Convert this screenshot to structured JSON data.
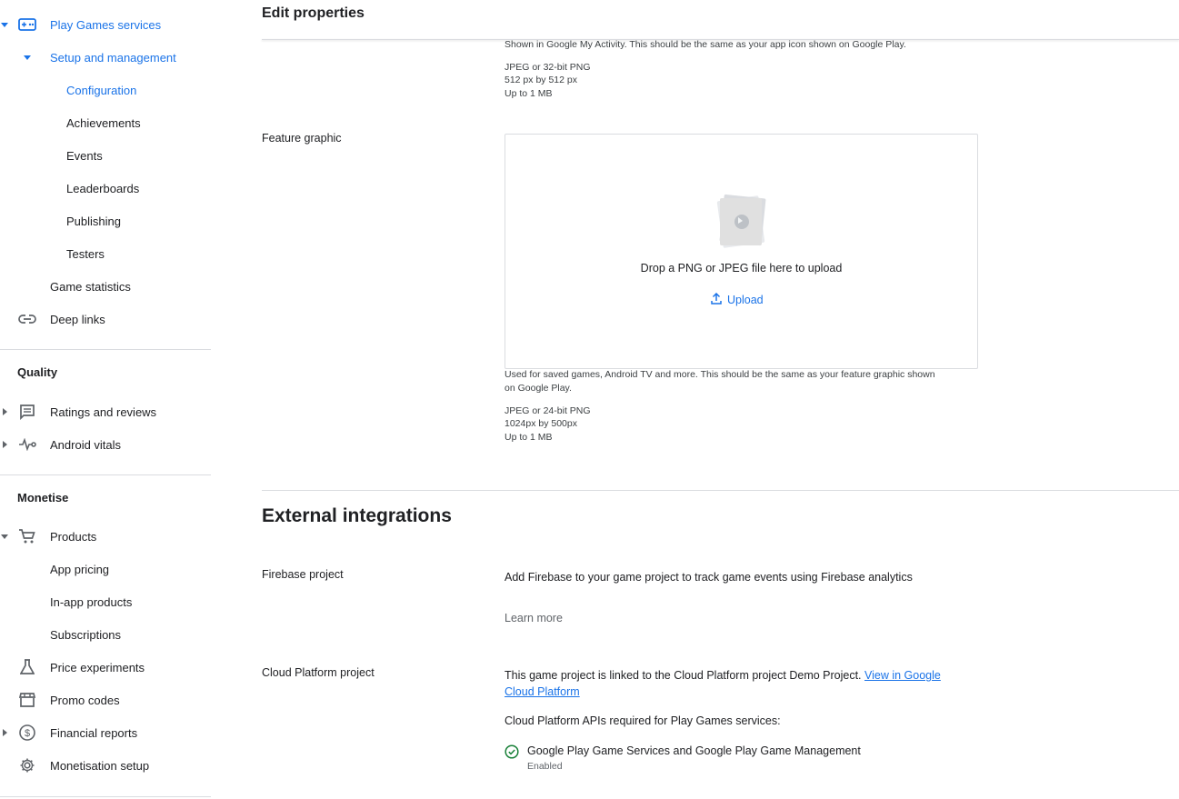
{
  "sidebar": {
    "play_games_services": "Play Games services",
    "setup_and_management": "Setup and management",
    "configuration": "Configuration",
    "achievements": "Achievements",
    "events": "Events",
    "leaderboards": "Leaderboards",
    "publishing": "Publishing",
    "testers": "Testers",
    "game_statistics": "Game statistics",
    "deep_links": "Deep links",
    "quality_heading": "Quality",
    "ratings_and_reviews": "Ratings and reviews",
    "android_vitals": "Android vitals",
    "monetise_heading": "Monetise",
    "products": "Products",
    "app_pricing": "App pricing",
    "in_app_products": "In-app products",
    "subscriptions": "Subscriptions",
    "price_experiments": "Price experiments",
    "promo_codes": "Promo codes",
    "financial_reports": "Financial reports",
    "monetisation_setup": "Monetisation setup"
  },
  "header": {
    "title": "Edit properties"
  },
  "icon_section": {
    "help": "Shown in Google My Activity. This should be the same as your app icon shown on Google Play.",
    "format": "JPEG or 32-bit PNG",
    "size": "512 px by 512 px",
    "max": "Up to 1 MB"
  },
  "feature_graphic": {
    "label": "Feature graphic",
    "drop_text": "Drop a PNG or JPEG file here to upload",
    "upload_label": "Upload",
    "help_line1": "Used for saved games, Android TV and more. This should be the same as your feature graphic shown",
    "help_line2": "on Google Play.",
    "format": "JPEG or 24-bit PNG",
    "size": "1024px by 500px",
    "max": "Up to 1 MB"
  },
  "external": {
    "title": "External integrations",
    "firebase_label": "Firebase project",
    "firebase_text": "Add Firebase to your game project to track game events using Firebase analytics",
    "learn_more": "Learn more",
    "cloud_label": "Cloud Platform project",
    "cloud_text": "This game project is linked to the Cloud Platform project Demo Project.",
    "cloud_link_line1": "View in Google",
    "cloud_link_line2": "Cloud Platform",
    "apis_text": "Cloud Platform APIs required for Play Games services:",
    "api_name": "Google Play Game Services and Google Play Game Management",
    "api_status": "Enabled"
  },
  "colors": {
    "accent": "#1a73e8",
    "success": "#188038",
    "divider": "#dadce0"
  }
}
